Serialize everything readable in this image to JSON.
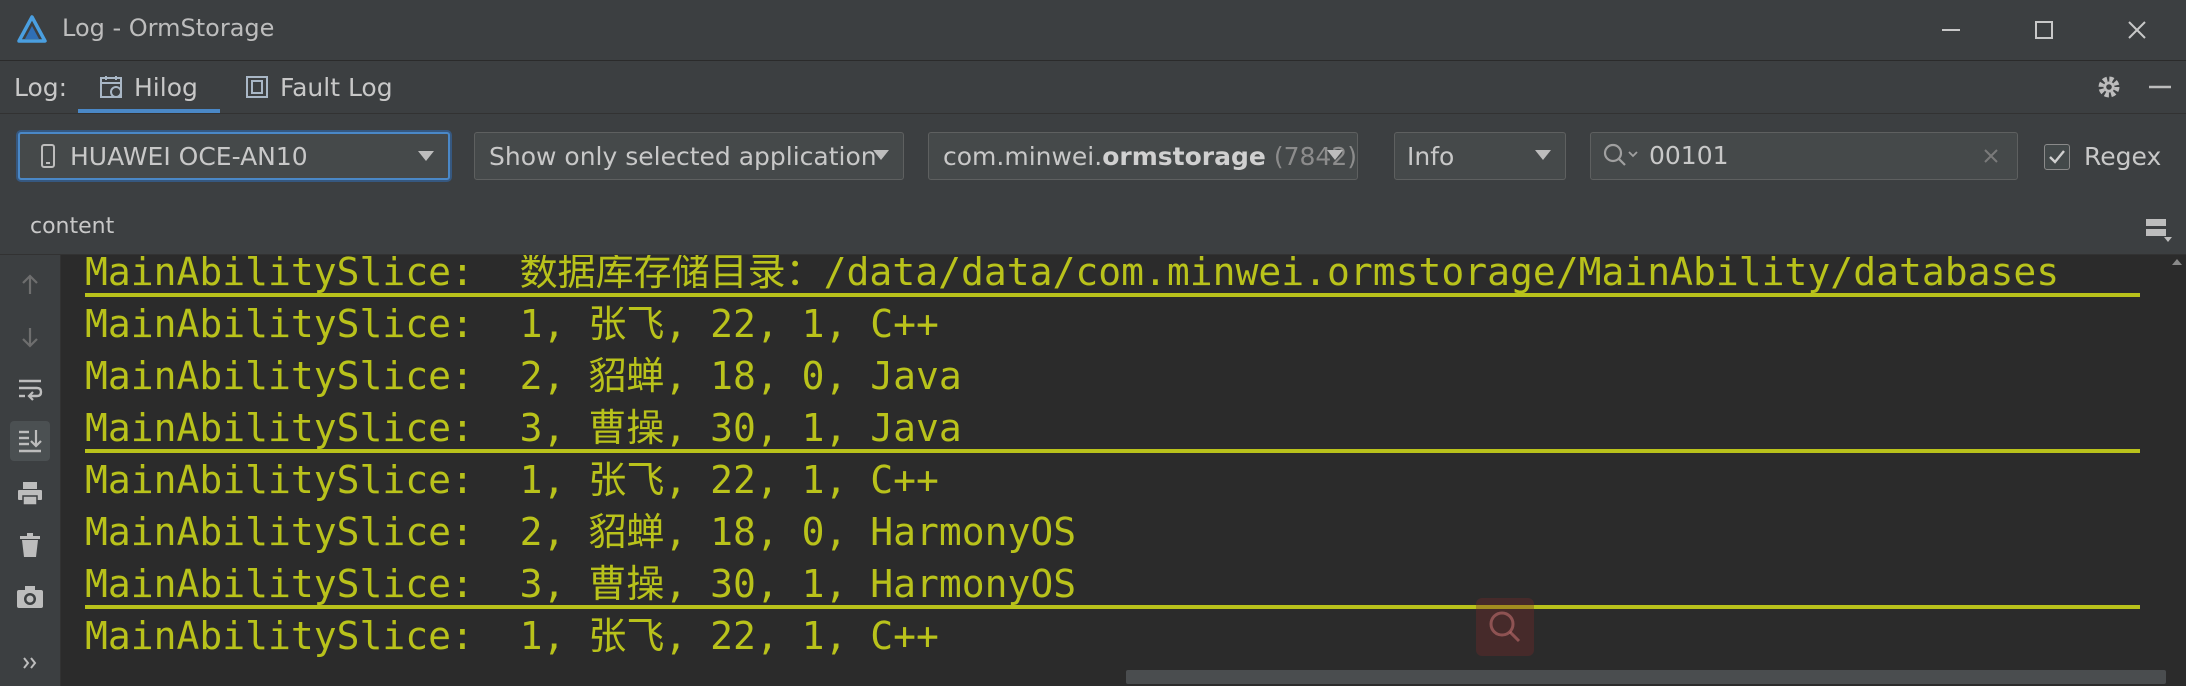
{
  "window": {
    "title": "Log - OrmStorage",
    "controls": [
      "minimize",
      "maximize",
      "close"
    ]
  },
  "tabbar": {
    "log_label": "Log:",
    "tabs": [
      {
        "label": "Hilog",
        "icon": "hilog-icon",
        "active": true
      },
      {
        "label": "Fault Log",
        "icon": "fault-log-icon",
        "active": false
      }
    ]
  },
  "filters": {
    "device": "HUAWEI OCE-AN10",
    "scope": "Show only selected application",
    "package_prefix": "com.minwei.",
    "package_bold": "ormstorage",
    "package_pid": "(7842)",
    "level": "Info",
    "search_value": "00101",
    "regex_label": "Regex",
    "regex_checked": true
  },
  "content_header": {
    "label": "content"
  },
  "log_lines": [
    "MainAbilitySlice:  数据库存储目录：/data/data/com.minwei.ormstorage/MainAbility/databases",
    "MainAbilitySlice:  1, 张飞, 22, 1, C++",
    "MainAbilitySlice:  2, 貂蝉, 18, 0, Java",
    "MainAbilitySlice:  3, 曹操, 30, 1, Java",
    "MainAbilitySlice:  1, 张飞, 22, 1, C++",
    "MainAbilitySlice:  2, 貂蝉, 18, 0, HarmonyOS",
    "MainAbilitySlice:  3, 曹操, 30, 1, HarmonyOS",
    "MainAbilitySlice:  1, 张飞, 22, 1, C++"
  ],
  "colors": {
    "log_text": "#b9c21b",
    "panel_bg": "#3c3f41",
    "editor_bg": "#2b2b2b",
    "accent": "#4a88c7"
  }
}
